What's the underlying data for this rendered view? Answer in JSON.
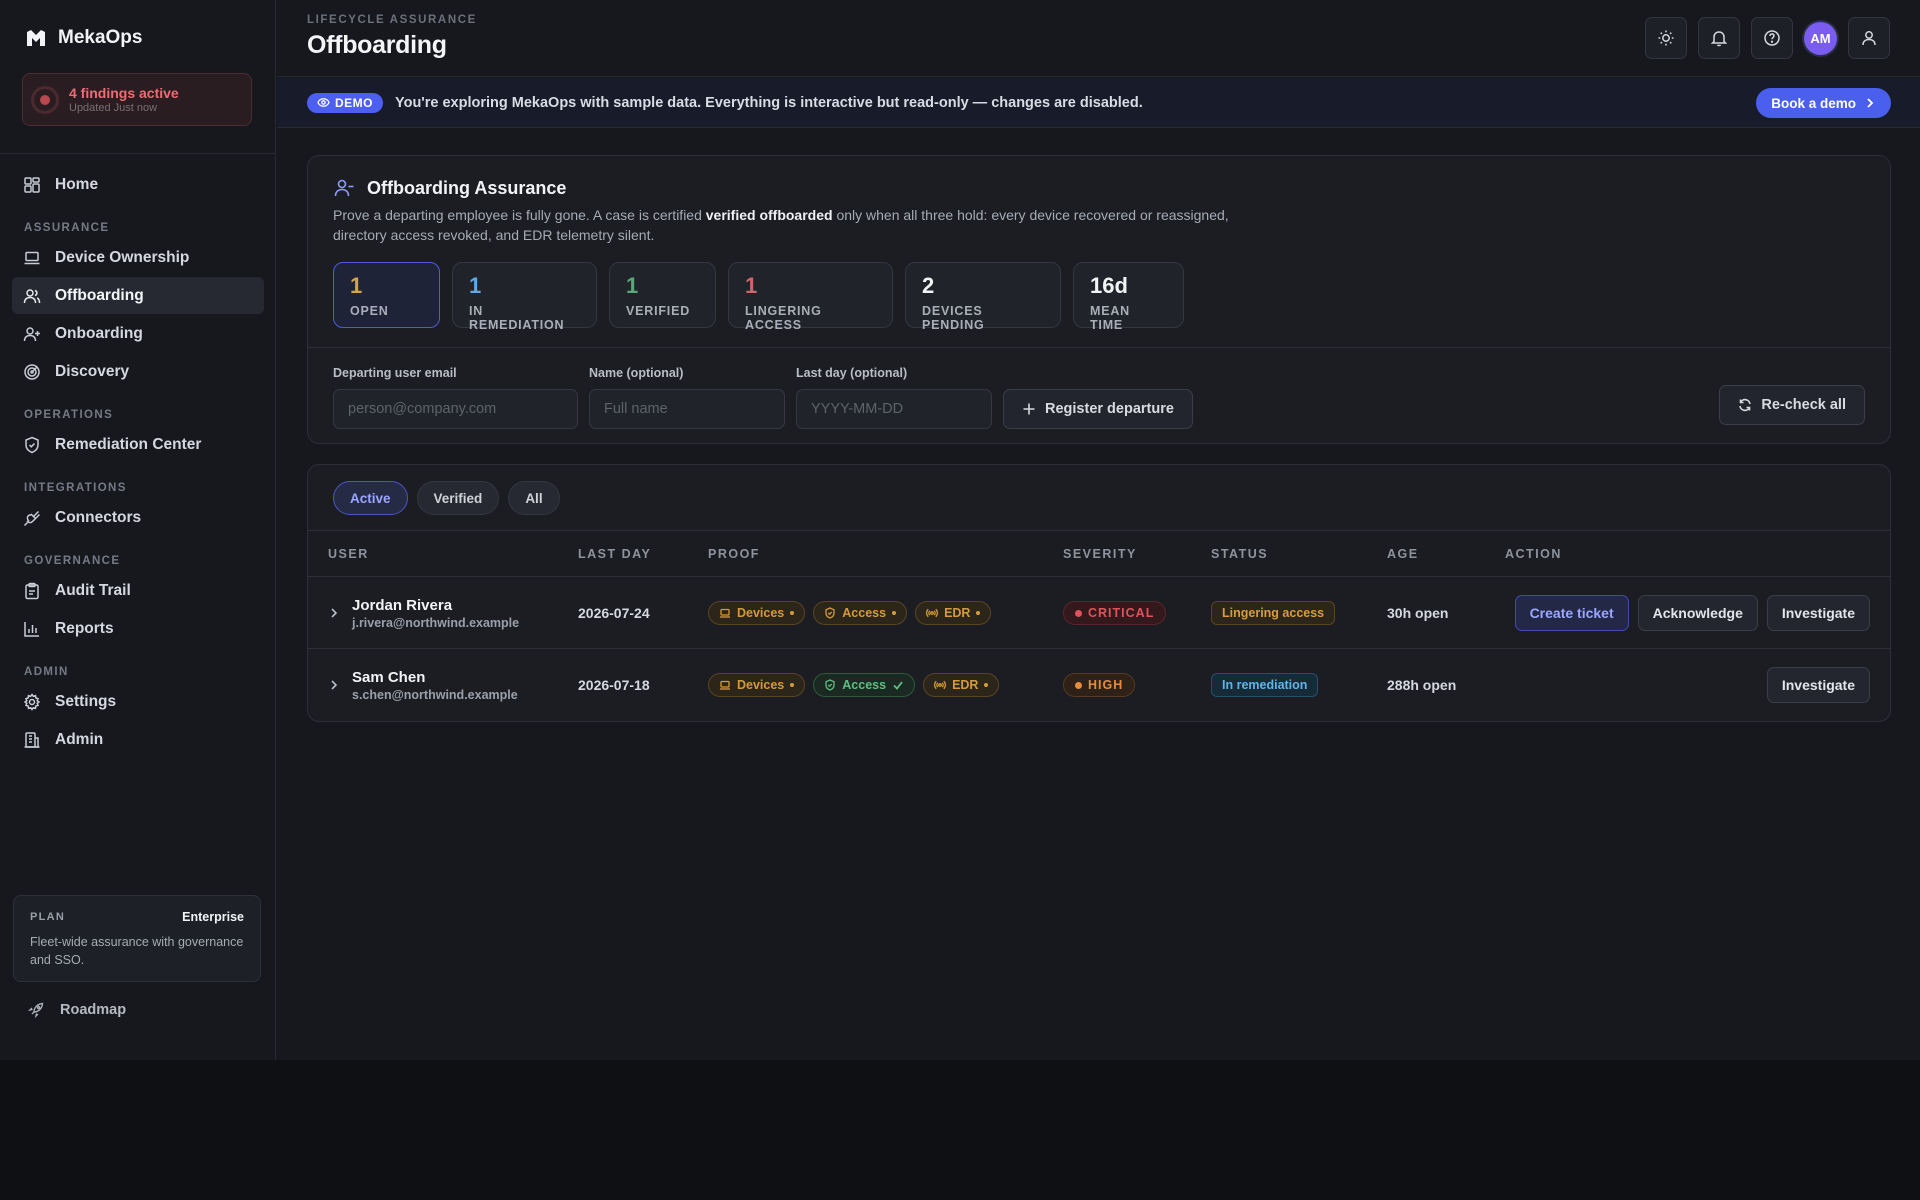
{
  "app": {
    "brand": "MekaOps",
    "findings_title": "4 findings active",
    "findings_sub": "Updated Just now"
  },
  "nav": {
    "home": "Home",
    "section_assurance": "ASSURANCE",
    "device_ownership": "Device Ownership",
    "offboarding": "Offboarding",
    "onboarding": "Onboarding",
    "discovery": "Discovery",
    "section_operations": "OPERATIONS",
    "remediation_center": "Remediation Center",
    "section_integrations": "INTEGRATIONS",
    "connectors": "Connectors",
    "section_governance": "GOVERNANCE",
    "audit_trail": "Audit Trail",
    "reports": "Reports",
    "section_admin": "ADMIN",
    "settings": "Settings",
    "admin": "Admin"
  },
  "plan": {
    "label": "PLAN",
    "tier": "Enterprise",
    "desc": "Fleet-wide assurance with governance and SSO."
  },
  "roadmap": "Roadmap",
  "header": {
    "eyebrow": "LIFECYCLE ASSURANCE",
    "title": "Offboarding",
    "avatar": "AM"
  },
  "demo": {
    "pill": "DEMO",
    "text": "You're exploring MekaOps with sample data. Everything is interactive but read-only — changes are disabled.",
    "button": "Book a demo"
  },
  "assurance": {
    "title": "Offboarding Assurance",
    "desc_pre": "Prove a departing employee is fully gone. A case is certified ",
    "desc_bold": "verified offboarded",
    "desc_post": " only when all three hold: every device recovered or reassigned, directory access revoked, and EDR telemetry silent."
  },
  "stats": [
    {
      "value": "1",
      "label": "OPEN",
      "color": "#d6a24a"
    },
    {
      "value": "1",
      "label": "IN REMEDIATION",
      "color": "#5fa9e6"
    },
    {
      "value": "1",
      "label": "VERIFIED",
      "color": "#5aa87a"
    },
    {
      "value": "1",
      "label": "LINGERING ACCESS",
      "color": "#d0646c"
    },
    {
      "value": "2",
      "label": "DEVICES PENDING",
      "color": "#f2f3f5"
    },
    {
      "value": "16d",
      "label": "MEAN TIME",
      "color": "#f2f3f5"
    }
  ],
  "form": {
    "email_label": "Departing user email",
    "email_placeholder": "person@company.com",
    "name_label": "Name (optional)",
    "name_placeholder": "Full name",
    "lastday_label": "Last day (optional)",
    "lastday_placeholder": "YYYY-MM-DD",
    "register": "Register departure",
    "recheck": "Re-check all"
  },
  "filters": [
    "Active",
    "Verified",
    "All"
  ],
  "table": {
    "columns": [
      "USER",
      "LAST DAY",
      "PROOF",
      "SEVERITY",
      "STATUS",
      "AGE",
      "ACTION"
    ],
    "rows": [
      {
        "name": "Jordan Rivera",
        "email": "j.rivera@northwind.example",
        "last_day": "2026-07-24",
        "proof": [
          "Devices",
          "Access",
          "EDR"
        ],
        "severity": "CRITICAL",
        "status": "Lingering access",
        "age": "30h open",
        "actions": [
          "Create ticket",
          "Acknowledge",
          "Investigate"
        ]
      },
      {
        "name": "Sam Chen",
        "email": "s.chen@northwind.example",
        "last_day": "2026-07-18",
        "proof": [
          "Devices",
          "Access",
          "EDR"
        ],
        "severity": "HIGH",
        "status": "In remediation",
        "age": "288h open",
        "actions": [
          "Investigate"
        ]
      }
    ]
  }
}
